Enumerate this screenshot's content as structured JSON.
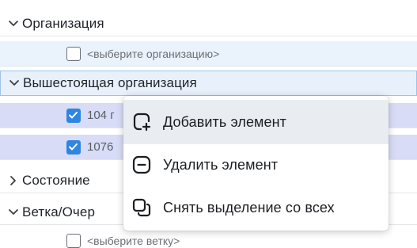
{
  "tree": {
    "sections": [
      {
        "label": "Организация",
        "expanded": true
      },
      {
        "label": "Вышестоящая организация",
        "expanded": true
      },
      {
        "label": "Состояние",
        "expanded": false
      },
      {
        "label": "Ветка/Очер",
        "expanded": true
      }
    ],
    "org_option": {
      "text": "<выберите организацию>",
      "checked": false
    },
    "parent_org_items": [
      {
        "text": "104 г",
        "checked": true
      },
      {
        "text": "1076",
        "checked": true
      }
    ],
    "branch_option": {
      "text": "<выберите ветку>",
      "checked": false
    }
  },
  "context_menu": {
    "items": [
      {
        "label": "Добавить элемент",
        "icon": "add-element-icon"
      },
      {
        "label": "Удалить элемент",
        "icon": "remove-element-icon"
      },
      {
        "label": "Снять выделение со всех",
        "icon": "deselect-all-icon"
      }
    ]
  },
  "colors": {
    "accent": "#2e86e0",
    "selected_row": "#d8dcf6",
    "active_section": "#e8f1fb",
    "menu_hover": "#e9edf2"
  }
}
